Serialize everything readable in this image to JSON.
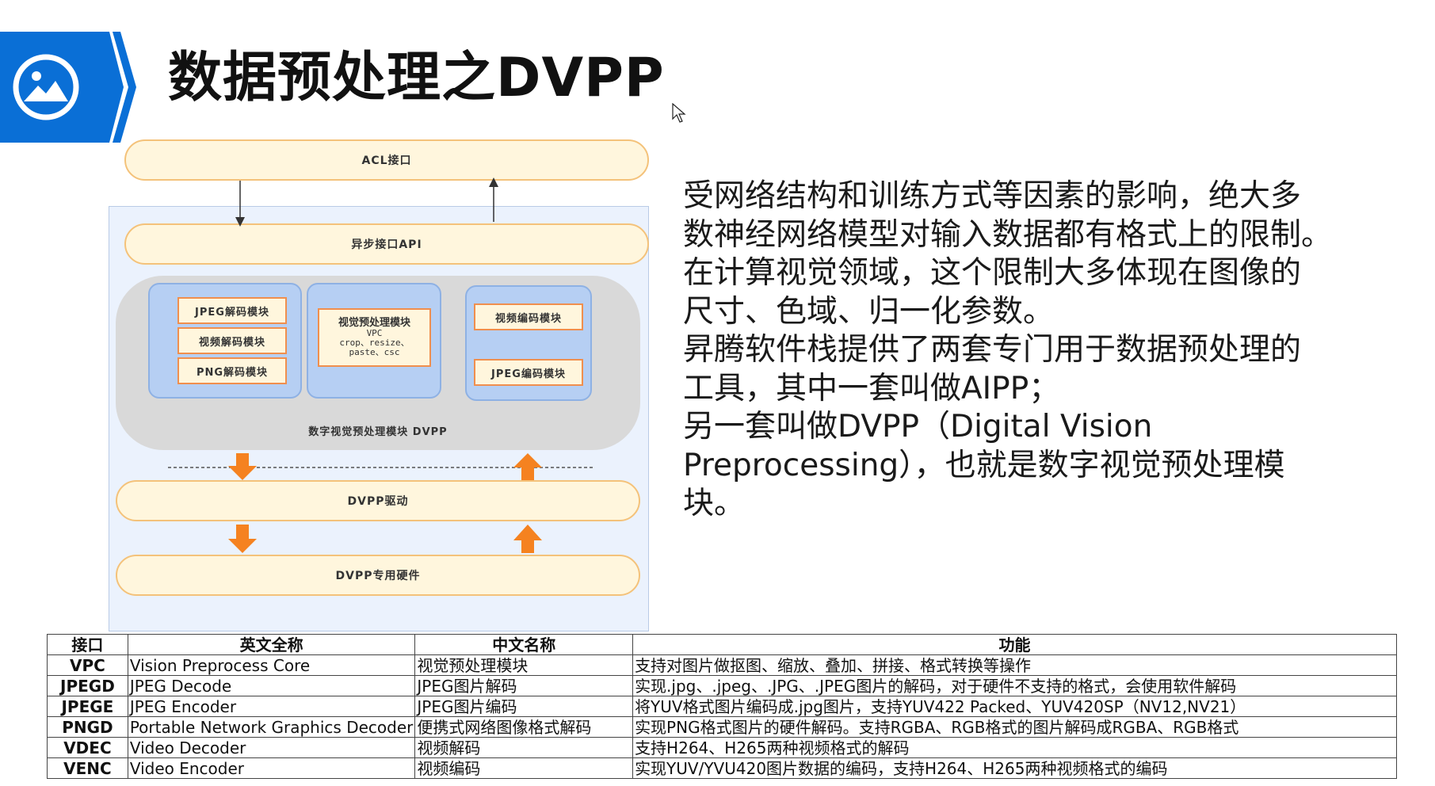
{
  "header": {
    "title": "数据预处理之DVPP",
    "badge_icon": "image-icon",
    "accent_color": "#0a6fd6"
  },
  "diagram": {
    "acl": "ACL接口",
    "async_api": "异步接口API",
    "modules_left": [
      "JPEG解码模块",
      "视频解码模块",
      "PNG解码模块"
    ],
    "vpc": {
      "title": "视觉预处理模块",
      "name": "VPC",
      "ops": "crop、resize、",
      "ops2": "paste、csc"
    },
    "modules_right": [
      "视频编码模块",
      "JPEG编码模块"
    ],
    "panel_label": "数字视觉预处理模块 DVPP",
    "driver": "DVPP驱动",
    "hardware": "DVPP专用硬件"
  },
  "description": {
    "lines": [
      "受网络结构和训练方式等因素的影响，绝大多",
      "数神经网络模型对输入数据都有格式上的限制。",
      "在计算视觉领域，这个限制大多体现在图像的",
      "尺寸、色域、归一化参数。",
      "昇腾软件栈提供了两套专门用于数据预处理的",
      "工具，其中一套叫做AIPP；",
      "另一套叫做DVPP（Digital Vision",
      "Preprocessing），也就是数字视觉预处理模",
      "块。"
    ]
  },
  "table": {
    "headers": [
      "接口",
      "英文全称",
      "中文名称",
      "功能"
    ],
    "rows": [
      [
        "VPC",
        "Vision Preprocess Core",
        "视觉预处理模块",
        "支持对图片做抠图、缩放、叠加、拼接、格式转换等操作"
      ],
      [
        "JPEGD",
        "JPEG Decode",
        "JPEG图片解码",
        "实现.jpg、.jpeg、.JPG、.JPEG图片的解码，对于硬件不支持的格式，会使用软件解码"
      ],
      [
        "JPEGE",
        "JPEG Encoder",
        "JPEG图片编码",
        "将YUV格式图片编码成.jpg图片，支持YUV422 Packed、YUV420SP（NV12,NV21）"
      ],
      [
        "PNGD",
        "Portable Network Graphics Decoder",
        "便携式网络图像格式解码",
        "实现PNG格式图片的硬件解码。支持RGBA、RGB格式的图片解码成RGBA、RGB格式"
      ],
      [
        "VDEC",
        "Video Decoder",
        "视频解码",
        "支持H264、H265两种视频格式的解码"
      ],
      [
        "VENC",
        "Video Encoder",
        "视频编码",
        "实现YUV/YVU420图片数据的编码，支持H264、H265两种视频格式的编码"
      ]
    ]
  }
}
